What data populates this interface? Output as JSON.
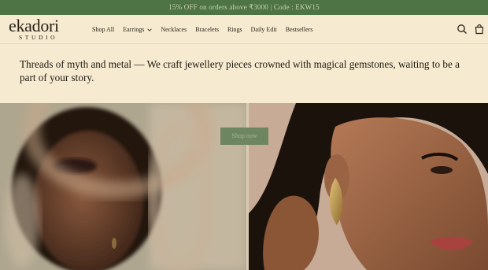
{
  "announcement": {
    "text": "15% OFF on orders above ₹3000 | Code : EKW15"
  },
  "brand": {
    "name": "ekadori",
    "subtitle": "STUDIO"
  },
  "nav": {
    "items": [
      {
        "label": "Shop All"
      },
      {
        "label": "Earrings",
        "has_dropdown": true
      },
      {
        "label": "Necklaces"
      },
      {
        "label": "Bracelets"
      },
      {
        "label": "Rings"
      },
      {
        "label": "Daily Edit"
      },
      {
        "label": "Bestsellers"
      }
    ]
  },
  "header_icons": [
    "search-icon",
    "cart-icon"
  ],
  "hero": {
    "text": "Threads of myth and metal — We craft jewellery pieces crowned with magical gemstones, waiting to be a part of your story.",
    "button_label": "Shop now"
  },
  "colors": {
    "announcement_bg": "#4e7344",
    "page_bg": "#f6ead0",
    "button_bg": "#6e8561"
  }
}
